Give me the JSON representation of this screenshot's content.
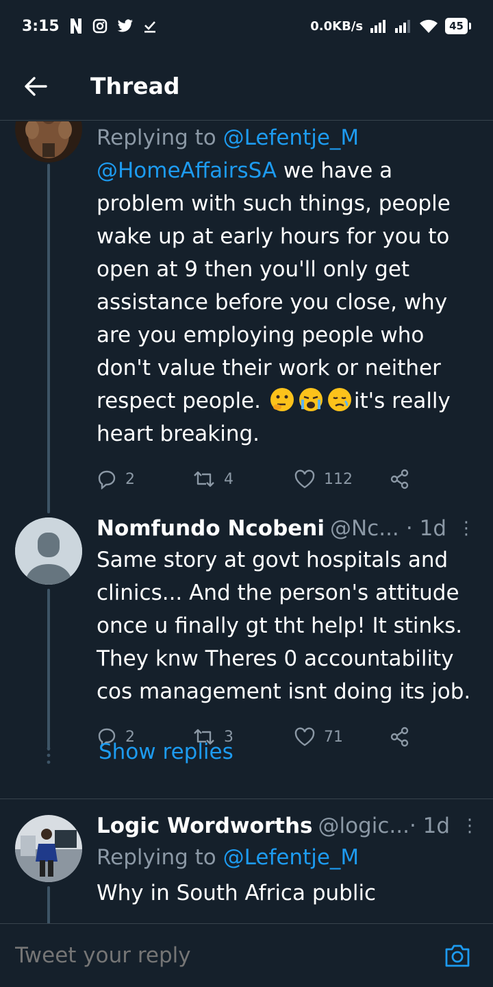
{
  "status_bar": {
    "time": "3:15",
    "net_speed": "0.0KB/s",
    "battery": "45"
  },
  "header": {
    "title": "Thread"
  },
  "tweets": [
    {
      "replying_prefix": "Replying to",
      "replying_to": "@Lefentje_M",
      "mention": "@HomeAffairsSA",
      "text": " we have a problem with such things, people wake up at early hours for you to open at 9 then you'll only get assistance before you close, why are you employing people who don't value their work or neither respect people. ",
      "text_tail": "it's really heart breaking.",
      "replies": "2",
      "retweets": "4",
      "likes": "112"
    },
    {
      "name": "Nomfundo Ncobeni",
      "handle": "@Nc...",
      "time": "· 1d",
      "text": "Same story at govt hospitals and clinics... And the person's attitude once u finally gt tht help! It stinks. They knw Theres 0 accountability cos management isnt doing its job.",
      "replies": "2",
      "retweets": "3",
      "likes": "71",
      "show_replies": "Show replies"
    },
    {
      "name": "Logic Wordworths",
      "handle": "@logic...",
      "time": "· 1d",
      "replying_prefix": "Replying to",
      "replying_to": "@Lefentje_M",
      "text": "Why in South Africa public"
    }
  ],
  "reply_bar": {
    "placeholder": "Tweet your reply"
  },
  "colors": {
    "background": "#15202b",
    "accent": "#1d9bf0",
    "muted": "#8b98a5",
    "divider": "#38444d"
  }
}
